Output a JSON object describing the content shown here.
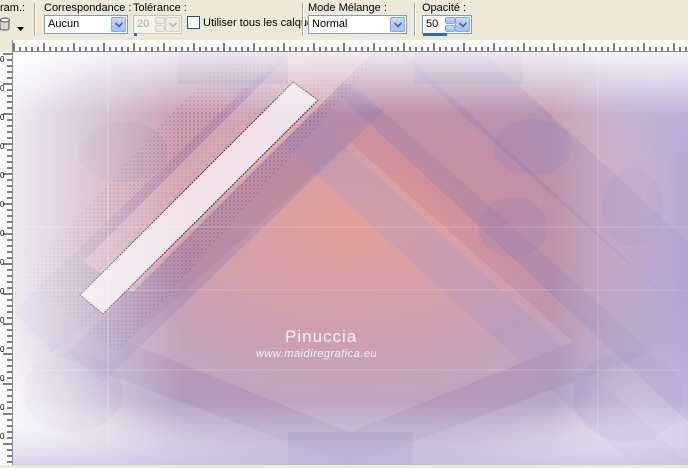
{
  "toolbar": {
    "preset_label": "ram.:",
    "correspondance": {
      "label": "Correspondance :",
      "value": "Aucun"
    },
    "tolerance": {
      "label": "Tolérance :",
      "value": "20"
    },
    "use_all_layers": {
      "label": "Utiliser tous les calques",
      "checked": false
    },
    "blend_mode": {
      "label": "Mode Mélange :",
      "value": "Normal"
    },
    "opacity": {
      "label": "Opacité :",
      "value": "50"
    }
  },
  "ruler": {
    "vertical_digits": [
      "0",
      "0",
      "0",
      "0",
      "0",
      "0",
      "0",
      "0",
      "0",
      "0",
      "0",
      "0",
      "0",
      "0"
    ]
  },
  "canvas": {
    "watermark_name": "Pinuccia",
    "watermark_url": "www.maidiregrafica.eu"
  },
  "colors": {
    "accent": "#316ac5",
    "canvas_peach": "#f59a86",
    "canvas_lavender": "#9a8cc8"
  },
  "icons": {
    "preset": "preset-icon",
    "dropdown": "chevron-down-icon"
  }
}
